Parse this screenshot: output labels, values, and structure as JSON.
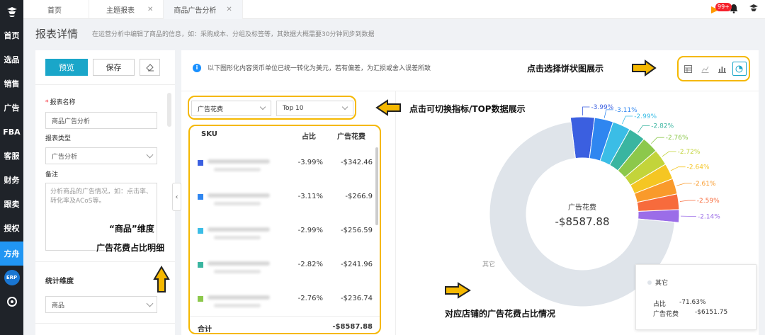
{
  "leftnav": {
    "items": [
      "首页",
      "选品",
      "销售",
      "广告",
      "FBA",
      "客服",
      "财务",
      "跟卖",
      "授权",
      "方舟"
    ],
    "erp": "ERP"
  },
  "tabs": [
    {
      "label": "首页",
      "closable": false,
      "active": false
    },
    {
      "label": "主题报表",
      "closable": true,
      "active": false
    },
    {
      "label": "商品广告分析",
      "closable": true,
      "active": true
    }
  ],
  "topright": {
    "badge": "99+"
  },
  "page": {
    "title": "报表详情",
    "description": "在运营分析中编辑了商品的信息，如：采购成本、分组及标签等，其数据大概需要30分钟同步到数据"
  },
  "form": {
    "preview_label": "预览",
    "save_label": "保存",
    "report_name_label": "报表名称",
    "report_name_value": "商品广告分析",
    "report_type_label": "报表类型",
    "report_type_value": "广告分析",
    "note_label": "备注",
    "note_placeholder": "分析商品的广告情况，如：点击率、转化率及ACoS等。",
    "dimension_label": "统计维度",
    "dimension_value": "商品"
  },
  "main": {
    "info_text": "以下图形化内容货币单位已统一转化为美元，若有偏差，为汇损或舍入误差所致",
    "metric_select": "广告花费",
    "top_select": "Top 10",
    "table": {
      "headers": [
        "SKU",
        "占比",
        "广告花费"
      ],
      "rows": [
        {
          "color": "#3b5fe0",
          "pct": "-3.99%",
          "amt": "-$342.46"
        },
        {
          "color": "#2f86f0",
          "pct": "-3.11%",
          "amt": "-$266.9"
        },
        {
          "color": "#3bbde6",
          "pct": "-2.99%",
          "amt": "-$256.59"
        },
        {
          "color": "#3ab5a0",
          "pct": "-2.82%",
          "amt": "-$241.96"
        },
        {
          "color": "#8cc84b",
          "pct": "-2.76%",
          "amt": "-$236.74"
        }
      ],
      "total_label": "合计",
      "total_value": "-$8587.88"
    }
  },
  "chart_data": {
    "type": "pie",
    "center_label": "广告花费",
    "center_value": "-$8587.88",
    "slices": [
      {
        "label": "-3.99%",
        "value": 3.99,
        "color": "#3b5fe0"
      },
      {
        "label": "-3.11%",
        "value": 3.11,
        "color": "#2f86f0"
      },
      {
        "label": "-2.99%",
        "value": 2.99,
        "color": "#3bbde6"
      },
      {
        "label": "-2.82%",
        "value": 2.82,
        "color": "#3ab5a0"
      },
      {
        "label": "-2.76%",
        "value": 2.76,
        "color": "#8cc84b"
      },
      {
        "label": "-2.72%",
        "value": 2.72,
        "color": "#c3d43a"
      },
      {
        "label": "-2.64%",
        "value": 2.64,
        "color": "#f5c623"
      },
      {
        "label": "-2.61%",
        "value": 2.61,
        "color": "#f99a2b"
      },
      {
        "label": "-2.59%",
        "value": 2.59,
        "color": "#f76b3c"
      },
      {
        "label": "-2.14%",
        "value": 2.14,
        "color": "#9b6de8"
      },
      {
        "label": "其它",
        "value": 71.63,
        "color": "#dfe4ea"
      }
    ],
    "tooltip": {
      "name": "其它",
      "pct_label": "占比",
      "pct_value": "-71.63%",
      "amt_label": "广告花费",
      "amt_value": "-$6151.75"
    }
  },
  "annotations": {
    "pie_tip": "点击选择饼状图展示",
    "switch_tip": "点击可切换指标/TOP数据展示",
    "dim_tip_1": "“商品”维度",
    "dim_tip_2": "广告花费占比明细",
    "store_tip": "对应店铺的广告花费占比情况"
  }
}
